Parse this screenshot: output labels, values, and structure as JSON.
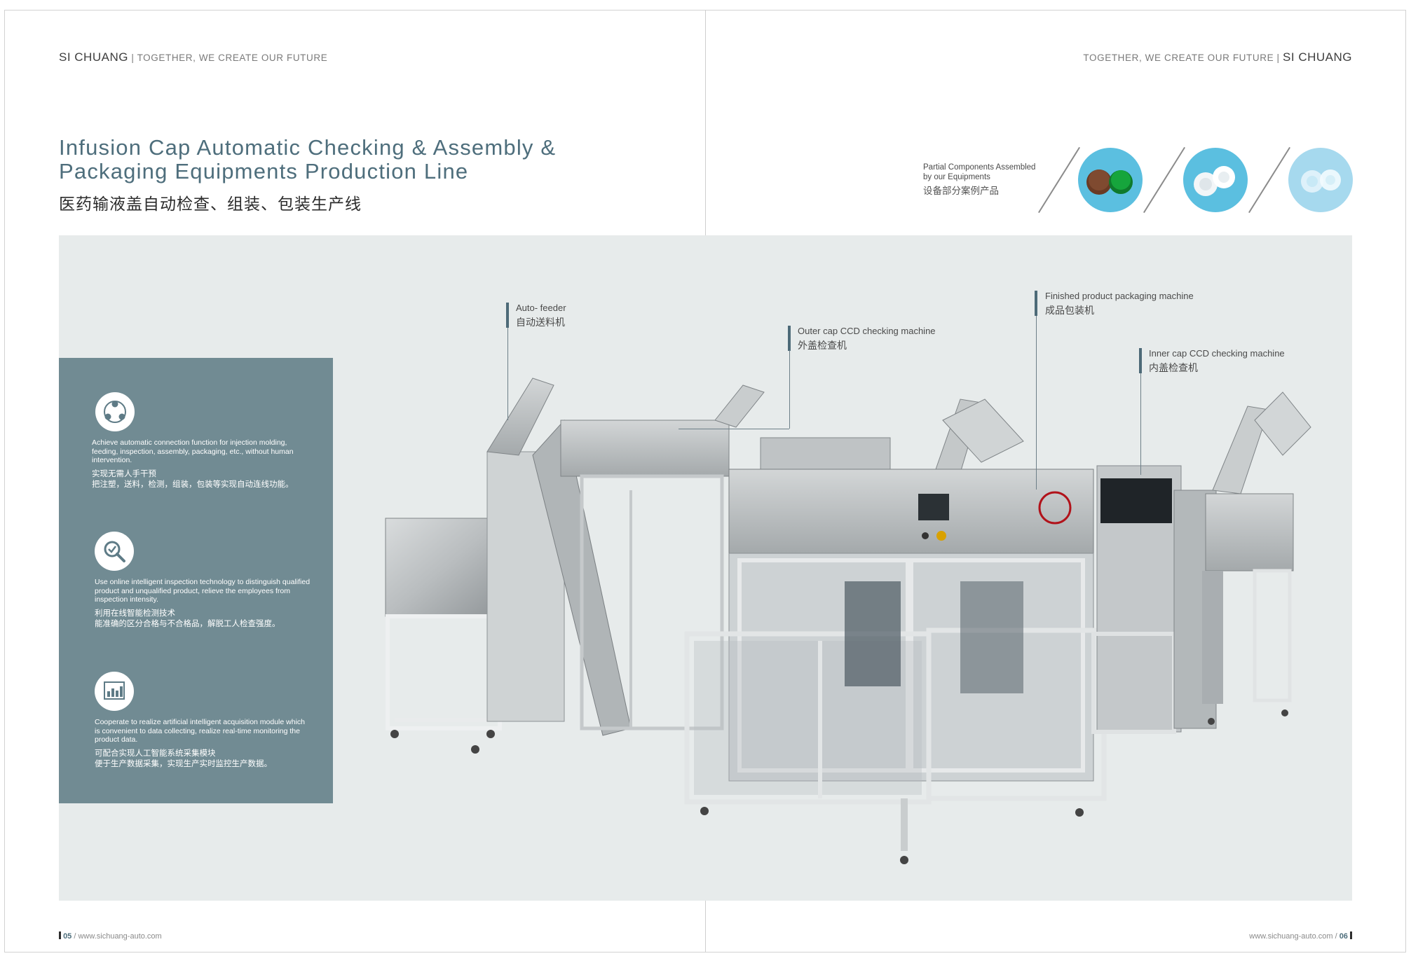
{
  "header": {
    "left_brand": "SI CHUANG",
    "left_tagline": "| TOGETHER, WE CREATE OUR FUTURE",
    "right_tagline": "TOGETHER, WE CREATE OUR FUTURE |",
    "right_brand": "SI CHUANG"
  },
  "title": {
    "line1": "Infusion Cap Automatic Checking & Assembly &",
    "line2": "Packaging Equipments Production Line",
    "cn": "医药输液盖自动检查、组装、包装生产线"
  },
  "partial_components": {
    "line1": "Partial Components Assembled",
    "line2": "by our Equipments",
    "cn": "设备部分案例产品"
  },
  "features": [
    {
      "icon": "connection-icon",
      "en": "Achieve automatic connection function for injection molding, feeding, inspection, assembly, packaging, etc., without human intervention.",
      "cn1": "实现无需人手干预",
      "cn2": "把注塑，送料，检测，组装，包装等实现自动连线功能。"
    },
    {
      "icon": "inspection-magnifier-icon",
      "en": "Use online intelligent inspection technology to distinguish qualified product and unqualified product, relieve the employees from inspection intensity.",
      "cn1": "利用在线智能检测技术",
      "cn2": "能准确的区分合格与不合格品，解脱工人检查强度。"
    },
    {
      "icon": "data-chart-icon",
      "en": "Cooperate to realize artificial intelligent acquisition module which is convenient to data collecting, realize real-time monitoring the product data.",
      "cn1": "可配合实现人工智能系统采集模块",
      "cn2": "便于生产数据采集，实现生产实时监控生产数据。"
    }
  ],
  "callouts": {
    "auto_feeder": {
      "en": "Auto- feeder",
      "cn": "自动送料机"
    },
    "outer_cap": {
      "en": "Outer cap CCD checking machine",
      "cn": "外盖检查机"
    },
    "finished": {
      "en": "Finished product packaging machine",
      "cn": "成品包装机"
    },
    "inner_cap": {
      "en": "Inner cap CCD checking machine",
      "cn": "内盖检查机"
    }
  },
  "footer": {
    "left_page": "05",
    "left_url": " / www.sichuang-auto.com",
    "right_url": "www.sichuang-auto.com / ",
    "right_page": "06"
  },
  "colors": {
    "accent": "#4e6e7c",
    "feature_panel": "#718b93",
    "product_panel": "#e7ebeb",
    "cap_blue": "#5bbfe0"
  }
}
